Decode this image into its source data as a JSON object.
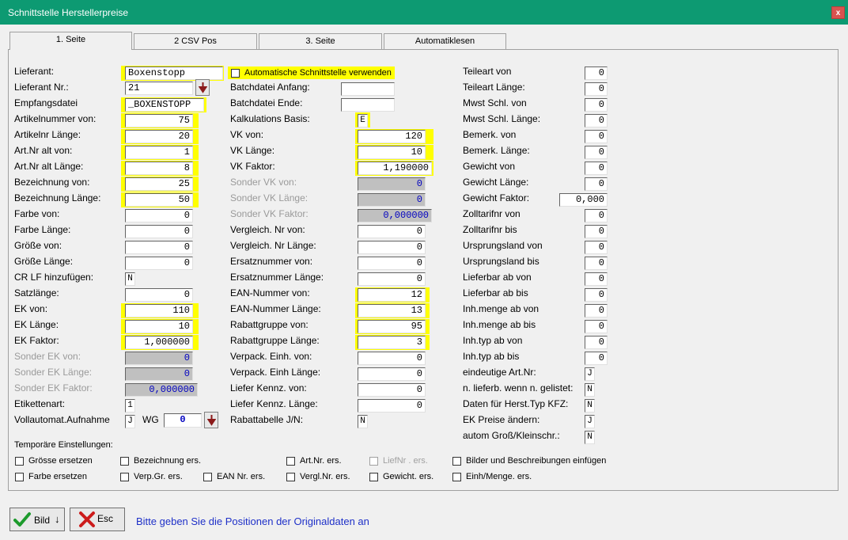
{
  "window": {
    "title": "Schnittstelle Herstellerpreise",
    "close": "x"
  },
  "tabs": [
    "1. Seite",
    "2 CSV Pos",
    "3. Seite",
    "Automatiklesen"
  ],
  "col1": {
    "lieferant_label": "Lieferant:",
    "lieferant_value": "Boxenstopp",
    "lieferant_nr_label": "Lieferant Nr.:",
    "lieferant_nr_value": "21",
    "empfangsdatei_label": "Empfangsdatei",
    "empfangsdatei_value": "_BOXENSTOPP",
    "rows": [
      {
        "label": "Artikelnummer von:",
        "value": "75"
      },
      {
        "label": "Artikelnr Länge:",
        "value": "20"
      },
      {
        "label": "Art.Nr alt von:",
        "value": "1"
      },
      {
        "label": "Art.Nr alt Länge:",
        "value": "8"
      },
      {
        "label": "Bezeichnung   von:",
        "value": "25"
      },
      {
        "label": "Bezeichnung Länge:",
        "value": "50"
      },
      {
        "label": "Farbe von:",
        "value": "0"
      },
      {
        "label": "Farbe Länge:",
        "value": "0"
      },
      {
        "label": "Größe von:",
        "value": "0"
      },
      {
        "label": "Größe Länge:",
        "value": "0"
      },
      {
        "label": "CR LF hinzufügen:",
        "value": "N"
      },
      {
        "label": "Satzlänge:",
        "value": "0"
      },
      {
        "label": "EK von:",
        "value": "110"
      },
      {
        "label": "EK Länge:",
        "value": "10"
      },
      {
        "label": "EK Faktor:",
        "value": "1,000000"
      },
      {
        "label": "Sonder EK von:",
        "value": "0"
      },
      {
        "label": "Sonder EK Länge:",
        "value": "0"
      },
      {
        "label": "Sonder EK Faktor:",
        "value": "0,000000"
      },
      {
        "label": "Etikettenart:",
        "value": "1"
      },
      {
        "label": "Vollautomat.Aufnahme",
        "value": "J"
      }
    ],
    "wg_label": "WG",
    "wg_value": "0"
  },
  "col2": {
    "auto_checkbox_label": "Automatische Schnittstelle verwenden",
    "rows": [
      {
        "label": "Batchdatei Anfang:",
        "value": ""
      },
      {
        "label": "Batchdatei Ende:",
        "value": ""
      },
      {
        "label": "Kalkulations Basis:",
        "value": "E"
      },
      {
        "label": "VK von:",
        "value": "120"
      },
      {
        "label": "VK Länge:",
        "value": "10"
      },
      {
        "label": "VK Faktor:",
        "value": "1,190000"
      },
      {
        "label": "Sonder VK von:",
        "value": "0"
      },
      {
        "label": "Sonder VK Länge:",
        "value": "0"
      },
      {
        "label": "Sonder VK Faktor:",
        "value": "0,000000"
      },
      {
        "label": "Vergleich. Nr von:",
        "value": "0"
      },
      {
        "label": "Vergleich. Nr Länge:",
        "value": "0"
      },
      {
        "label": "Ersatznummer   von:",
        "value": "0"
      },
      {
        "label": "Ersatznummer Länge:",
        "value": "0"
      },
      {
        "label": "EAN-Nummer     von:",
        "value": "12"
      },
      {
        "label": "EAN-Nummer   Länge:",
        "value": "13"
      },
      {
        "label": "Rabattgruppe  von:",
        "value": "95"
      },
      {
        "label": "Rabattgruppe  Länge:",
        "value": "3"
      },
      {
        "label": "Verpack. Einh. von:",
        "value": "0"
      },
      {
        "label": "Verpack. Einh Länge:",
        "value": "0"
      },
      {
        "label": "Liefer Kennz. von:",
        "value": "0"
      },
      {
        "label": "Liefer Kennz. Länge:",
        "value": "0"
      },
      {
        "label": "Rabattabelle J/N:",
        "value": "N"
      }
    ]
  },
  "col3": {
    "rows": [
      {
        "label": "Teileart von",
        "value": "0"
      },
      {
        "label": "Teileart Länge:",
        "value": "0"
      },
      {
        "label": "Mwst Schl. von",
        "value": "0"
      },
      {
        "label": "Mwst Schl. Länge:",
        "value": "0"
      },
      {
        "label": "Bemerk. von",
        "value": "0"
      },
      {
        "label": "Bemerk. Länge:",
        "value": "0"
      },
      {
        "label": "Gewicht von",
        "value": "0"
      },
      {
        "label": "Gewicht Länge:",
        "value": "0"
      },
      {
        "label": "Gewicht Faktor:",
        "value": "0,000"
      },
      {
        "label": "Zolltarifnr von",
        "value": "0"
      },
      {
        "label": "Zolltarifnr bis",
        "value": "0"
      },
      {
        "label": "Ursprungsland von",
        "value": "0"
      },
      {
        "label": "Ursprungsland bis",
        "value": "0"
      },
      {
        "label": "Lieferbar ab von",
        "value": "0"
      },
      {
        "label": "Lieferbar ab bis",
        "value": "0"
      },
      {
        "label": "Inh.menge ab von",
        "value": "0"
      },
      {
        "label": "Inh.menge ab bis",
        "value": "0"
      },
      {
        "label": "Inh.typ ab von",
        "value": "0"
      },
      {
        "label": "Inh.typ ab bis",
        "value": "0"
      },
      {
        "label": "eindeutige Art.Nr:",
        "value": "J"
      },
      {
        "label": "n. lieferb. wenn n. gelistet:",
        "value": "N"
      },
      {
        "label": "Daten für Herst.Typ KFZ:",
        "value": "N"
      },
      {
        "label": "EK Preise ändern:",
        "value": "J"
      },
      {
        "label": "autom Groß/Kleinschr.:",
        "value": "N"
      }
    ]
  },
  "temp": {
    "heading": "Temporäre Einstellungen:",
    "items": [
      "Grösse ersetzen",
      "Bezeichnung ers.",
      "Art.Nr. ers.",
      "LiefNr  . ers.",
      "Bilder und Beschreibungen einfügen",
      "Farbe ersetzen",
      "Verp.Gr. ers.",
      "EAN Nr. ers.",
      "Vergl.Nr. ers.",
      "Gewicht. ers.",
      "Einh/Menge. ers."
    ]
  },
  "footer": {
    "bild_label": "Bild",
    "esc_label": "Esc",
    "status": "Bitte geben Sie die Positionen der Originaldaten an"
  },
  "colors": {
    "titlebar": "#0d9a72",
    "highlight": "#ffff00",
    "status_text": "#1e30c8"
  }
}
